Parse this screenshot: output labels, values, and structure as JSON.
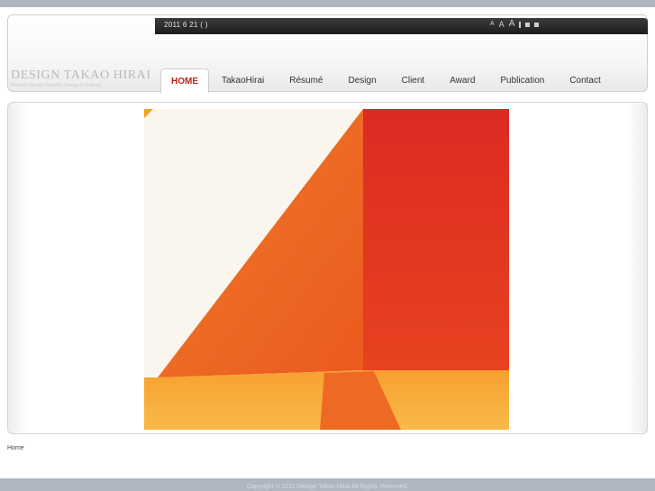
{
  "header": {
    "date": "2011 6 21 (   )",
    "logo_title": "DESIGN TAKAO HIRAI",
    "logo_subtitle": "Product Design Graphic Design Exhibition",
    "font_size_controls": [
      "A",
      "A",
      "A"
    ]
  },
  "nav": {
    "tabs": [
      {
        "label": "HOME",
        "active": true
      },
      {
        "label": "TakaoHirai",
        "active": false
      },
      {
        "label": "Résumé",
        "active": false
      },
      {
        "label": "Design",
        "active": false
      },
      {
        "label": "Client",
        "active": false
      },
      {
        "label": "Award",
        "active": false
      },
      {
        "label": "Publication",
        "active": false
      },
      {
        "label": "Contact",
        "active": false
      }
    ]
  },
  "breadcrumb": "Home",
  "footer": "Copyright © 2011 Design Takao Hirai All Rights Reserved.",
  "colors": {
    "accent": "#b8231b",
    "topbar": "#262626",
    "background": "#aeb6c2"
  }
}
